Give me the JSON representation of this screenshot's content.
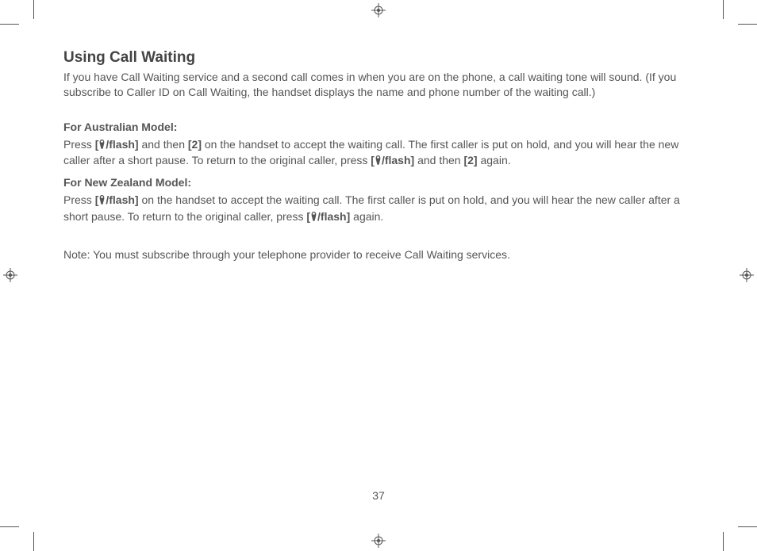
{
  "heading": "Using Call Waiting",
  "intro": "If you have Call Waiting service and a second call comes in when you are on the phone, a call waiting tone will sound. (If you subscribe to Caller ID on Call Waiting, the handset displays the name and phone number of the waiting call.)",
  "aus": {
    "title": "For Australian Model:",
    "p1a": "Press ",
    "key1": "[",
    "key1b": "/flash]",
    "p1b": " and then ",
    "key2": "[2]",
    "p1c": " on the handset to accept the waiting call. The first caller is put on hold, and you will hear the new caller after a short pause. To return to the original caller, press ",
    "key3": "[",
    "key3b": "/flash]",
    "p1d": " and then ",
    "key4": "[2]",
    "p1e": " again."
  },
  "nz": {
    "title": "For New Zealand Model:",
    "p1a": "Press ",
    "key1": "[",
    "key1b": "/flash]",
    "p1b": " on the handset to accept the waiting call. The first caller is put on hold, and you will hear the new caller after a short pause. To return to the original caller, press ",
    "key2": "[",
    "key2b": "/flash]",
    "p1c": " again."
  },
  "note": "Note: You must subscribe through your telephone provider to receive Call Waiting services.",
  "page_number": "37"
}
